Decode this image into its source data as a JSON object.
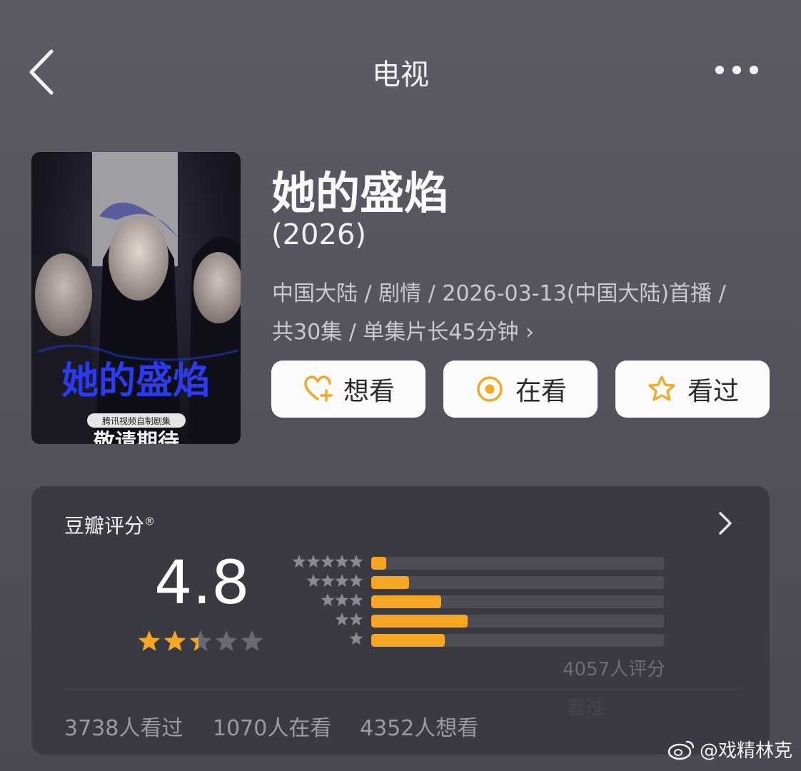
{
  "header": {
    "title": "电视",
    "back_icon": "chevron-left-icon",
    "more_icon": "more-dots-icon"
  },
  "show": {
    "title": "她的盛焰",
    "year": "(2026)",
    "meta_line1": "中国大陆 / 剧情 / 2026-03-13(中国大陆)首播 /",
    "meta_line2": "共30集 / 单集片长45分钟 ›",
    "poster": {
      "title_text": "她的盛焰",
      "badge_text": "腾讯视频自制剧集",
      "bottom_text": "敬请期待"
    }
  },
  "actions": [
    {
      "label": "想看",
      "icon": "heart-plus-icon"
    },
    {
      "label": "在看",
      "icon": "target-circle-icon"
    },
    {
      "label": "看过",
      "icon": "star-outline-icon"
    }
  ],
  "rating": {
    "title": "豆瓣评分",
    "registered": "®",
    "score": "4.8",
    "stars_fraction": 0.48,
    "distribution": [
      {
        "stars": 5,
        "fraction": 0.05
      },
      {
        "stars": 4,
        "fraction": 0.13
      },
      {
        "stars": 3,
        "fraction": 0.24
      },
      {
        "stars": 2,
        "fraction": 0.33
      },
      {
        "stars": 1,
        "fraction": 0.25
      }
    ],
    "count_text": "4057人评分",
    "ghost_text": "看过"
  },
  "stats": {
    "seen": "3738人看过",
    "watching": "1070人在看",
    "want": "4352人想看"
  },
  "watermark": "@戏精林克",
  "colors": {
    "accent": "#f5a623",
    "card_bg": "#3a3a42",
    "page_bg": "#5c5c66"
  }
}
